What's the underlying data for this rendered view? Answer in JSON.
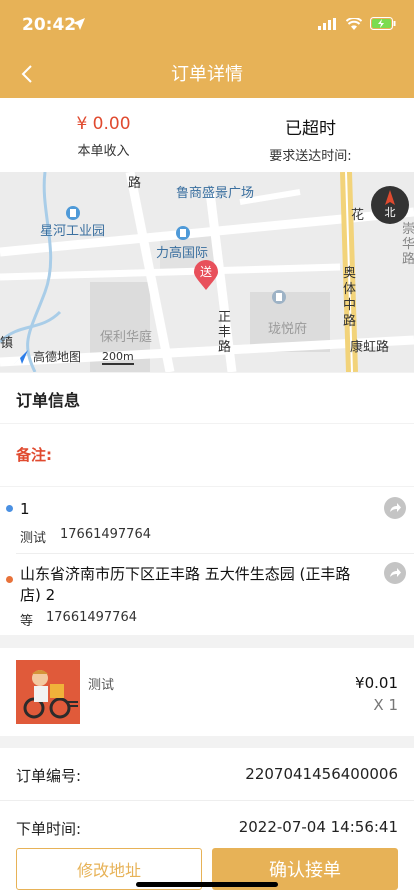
{
  "status_bar": {
    "time": "20:42"
  },
  "header": {
    "title": "订单详情"
  },
  "income": {
    "amount": "¥ 0.00",
    "amount_label": "本单收入",
    "status": "已超时",
    "status_label": "要求送达时间:"
  },
  "map": {
    "labels": {
      "lushang": "鲁商盛景广场",
      "xinghe": "星河工业园",
      "ligao": "力高国际",
      "baoli": "保利华庭",
      "longyue": "珑悦府",
      "zhengfeng": "正丰路",
      "aotizhong": "奥体中路",
      "kanghong": "康虹路",
      "hua": "花",
      "lu": "路",
      "chonghua": "崇华路",
      "zhen": "镇",
      "gaode": "高德地图",
      "scale": "200m",
      "compass": "北",
      "delivery_marker": "送"
    }
  },
  "order": {
    "section_title": "订单信息",
    "remark_label": "备注:",
    "pickup": {
      "name": "1",
      "contact": "测试",
      "phone": "17661497764"
    },
    "dropoff": {
      "address": "山东省济南市历下区正丰路 五大件生态园 (正丰路店) 2",
      "contact": "等",
      "phone": "17661497764"
    }
  },
  "goods": {
    "name": "测试",
    "price": "¥0.01",
    "qty": "X 1"
  },
  "info": {
    "order_no_label": "订单编号:",
    "order_no": "2207041456400006",
    "order_time_label": "下单时间:",
    "order_time": "2022-07-04 14:56:41"
  },
  "actions": {
    "modify": "修改地址",
    "confirm": "确认接单"
  },
  "colors": {
    "accent": "#e7b257",
    "price": "#e04a2f"
  }
}
